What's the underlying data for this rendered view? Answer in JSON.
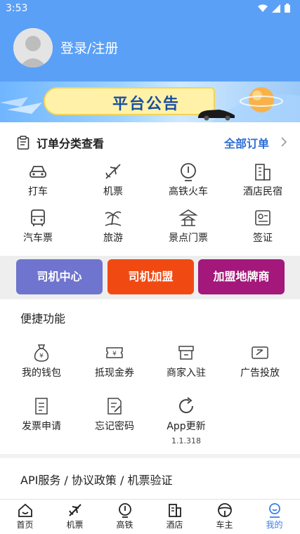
{
  "status_bar": {
    "time": "3:53"
  },
  "header": {
    "login_label": "登录/注册"
  },
  "banner": {
    "title": "平台公告"
  },
  "orders": {
    "title": "订单分类查看",
    "all_label": "全部订单",
    "categories": [
      "打车",
      "机票",
      "高铁火车",
      "酒店民宿",
      "汽车票",
      "旅游",
      "景点门票",
      "签证"
    ]
  },
  "actions": [
    {
      "label": "司机中心",
      "color": "#6f74cf"
    },
    {
      "label": "司机加盟",
      "color": "#f04a12"
    },
    {
      "label": "加盟地牌商",
      "color": "#a3187a"
    }
  ],
  "quick": {
    "title": "便捷功能",
    "items": [
      "我的钱包",
      "抵现金券",
      "商家入驻",
      "广告投放",
      "发票申请",
      "忘记密码",
      "App更新"
    ],
    "app_version": "1.1.318"
  },
  "services": {
    "text": "API服务 / 协议政策 / 机票验证"
  },
  "tabbar": {
    "tabs": [
      "首页",
      "机票",
      "高铁",
      "酒店",
      "车主",
      "我的"
    ],
    "active_color": "#3b7ee8"
  }
}
